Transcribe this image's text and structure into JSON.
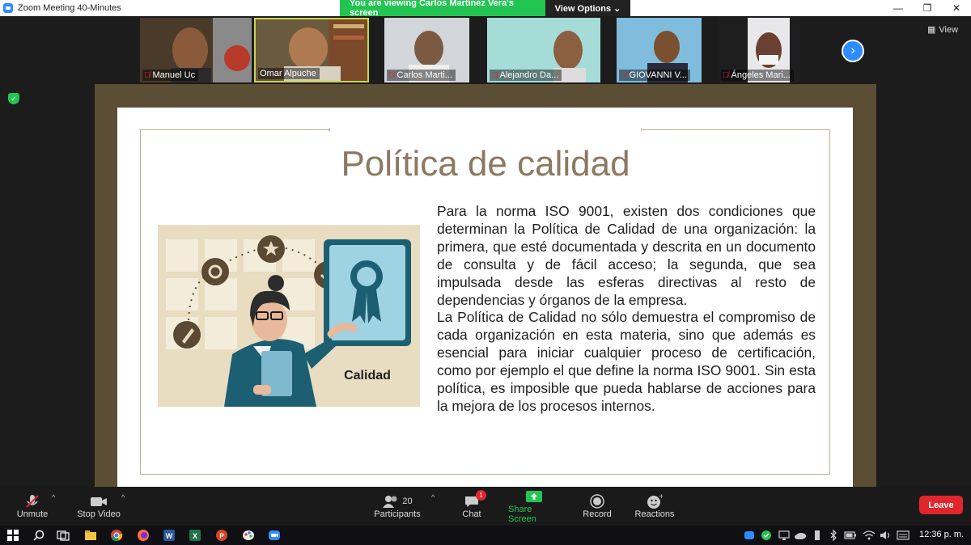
{
  "window": {
    "title": "Zoom Meeting 40-Minutes",
    "minimize": "—",
    "restore": "❐",
    "close": "✕"
  },
  "banner": {
    "viewing": "You are viewing Carlos Martínez Vera's screen",
    "view_options": "View Options ⌄"
  },
  "gallery": {
    "participants": [
      {
        "name": "Manuel Uc",
        "bg": "#5a4a36"
      },
      {
        "name": "Omar Alpuche",
        "bg": "#6b5a3e"
      },
      {
        "name": "Carlos Marti...",
        "bg": "#cfd3d8"
      },
      {
        "name": "Alejandro Da...",
        "bg": "#9fd8d6"
      },
      {
        "name": "GIOVANNI V...",
        "bg": "#7ab8d8"
      },
      {
        "name": "Ángeles Mari...",
        "bg": "#2a2a2a"
      }
    ],
    "view_label": "View"
  },
  "slide": {
    "title": "Política de calidad",
    "paragraph1": "Para la norma ISO 9001, existen dos condiciones que determinan la Política de Calidad de una organización: la primera, que esté documentada y descrita en un documento de consulta y de fácil acceso; la segunda, que sea impulsada desde las esferas directivas al resto de dependencias y órganos de la empresa.",
    "paragraph2": "La Política de Calidad no sólo demuestra el compromiso de cada organización en esta materia, sino que además es esencial para iniciar cualquier proceso de certificación, como por ejemplo el que define la norma ISO 9001. Sin esta política, es imposible que pueda hablarse de acciones para la mejora de los procesos internos.",
    "illustration_label": "Calidad"
  },
  "controls": {
    "unmute": "Unmute",
    "stop_video": "Stop Video",
    "participants": "Participants",
    "participants_count": "20",
    "chat": "Chat",
    "chat_badge": "1",
    "share_screen": "Share Screen",
    "record": "Record",
    "reactions": "Reactions",
    "leave": "Leave"
  },
  "system": {
    "time": "12:36 p. m."
  },
  "colors": {
    "zoom_blue": "#2d8cff",
    "banner_green": "#23c552",
    "leave_red": "#e0262c",
    "slide_title": "#8c7961",
    "frame_brown": "#5c4d35"
  }
}
